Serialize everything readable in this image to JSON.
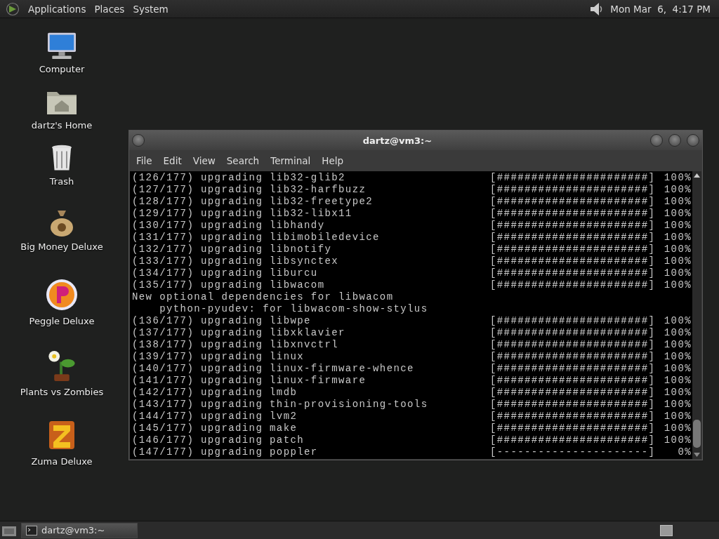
{
  "top_panel": {
    "menus": [
      "Applications",
      "Places",
      "System"
    ],
    "clock": "Mon Mar  6,  4:17 PM"
  },
  "desktop_icons": [
    {
      "label": "Computer",
      "kind": "computer"
    },
    {
      "label": "dartz's Home",
      "kind": "home"
    },
    {
      "label": "Trash",
      "kind": "trash"
    },
    {
      "label": "Big Money Deluxe",
      "kind": "money"
    },
    {
      "label": "Peggle Deluxe",
      "kind": "peggle"
    },
    {
      "label": "Plants vs Zombies",
      "kind": "plants"
    },
    {
      "label": "Zuma Deluxe",
      "kind": "zuma"
    }
  ],
  "terminal": {
    "title": "dartz@vm3:~",
    "menu": [
      "File",
      "Edit",
      "View",
      "Search",
      "Terminal",
      "Help"
    ],
    "lines": [
      {
        "kind": "progress",
        "text": "(126/177) upgrading lib32-glib2",
        "bar": "[######################]",
        "percent": "100%"
      },
      {
        "kind": "progress",
        "text": "(127/177) upgrading lib32-harfbuzz",
        "bar": "[######################]",
        "percent": "100%"
      },
      {
        "kind": "progress",
        "text": "(128/177) upgrading lib32-freetype2",
        "bar": "[######################]",
        "percent": "100%"
      },
      {
        "kind": "progress",
        "text": "(129/177) upgrading lib32-libx11",
        "bar": "[######################]",
        "percent": "100%"
      },
      {
        "kind": "progress",
        "text": "(130/177) upgrading libhandy",
        "bar": "[######################]",
        "percent": "100%"
      },
      {
        "kind": "progress",
        "text": "(131/177) upgrading libimobiledevice",
        "bar": "[######################]",
        "percent": "100%"
      },
      {
        "kind": "progress",
        "text": "(132/177) upgrading libnotify",
        "bar": "[######################]",
        "percent": "100%"
      },
      {
        "kind": "progress",
        "text": "(133/177) upgrading libsynctex",
        "bar": "[######################]",
        "percent": "100%"
      },
      {
        "kind": "progress",
        "text": "(134/177) upgrading liburcu",
        "bar": "[######################]",
        "percent": "100%"
      },
      {
        "kind": "progress",
        "text": "(135/177) upgrading libwacom",
        "bar": "[######################]",
        "percent": "100%"
      },
      {
        "kind": "text",
        "text": "New optional dependencies for libwacom"
      },
      {
        "kind": "text",
        "text": "    python-pyudev: for libwacom-show-stylus"
      },
      {
        "kind": "progress",
        "text": "(136/177) upgrading libwpe",
        "bar": "[######################]",
        "percent": "100%"
      },
      {
        "kind": "progress",
        "text": "(137/177) upgrading libxklavier",
        "bar": "[######################]",
        "percent": "100%"
      },
      {
        "kind": "progress",
        "text": "(138/177) upgrading libxnvctrl",
        "bar": "[######################]",
        "percent": "100%"
      },
      {
        "kind": "progress",
        "text": "(139/177) upgrading linux",
        "bar": "[######################]",
        "percent": "100%"
      },
      {
        "kind": "progress",
        "text": "(140/177) upgrading linux-firmware-whence",
        "bar": "[######################]",
        "percent": "100%"
      },
      {
        "kind": "progress",
        "text": "(141/177) upgrading linux-firmware",
        "bar": "[######################]",
        "percent": "100%"
      },
      {
        "kind": "progress",
        "text": "(142/177) upgrading lmdb",
        "bar": "[######################]",
        "percent": "100%"
      },
      {
        "kind": "progress",
        "text": "(143/177) upgrading thin-provisioning-tools",
        "bar": "[######################]",
        "percent": "100%"
      },
      {
        "kind": "progress",
        "text": "(144/177) upgrading lvm2",
        "bar": "[######################]",
        "percent": "100%"
      },
      {
        "kind": "progress",
        "text": "(145/177) upgrading make",
        "bar": "[######################]",
        "percent": "100%"
      },
      {
        "kind": "progress",
        "text": "(146/177) upgrading patch",
        "bar": "[######################]",
        "percent": "100%"
      },
      {
        "kind": "progress",
        "text": "(147/177) upgrading poppler",
        "bar": "[----------------------]",
        "percent": "0%"
      }
    ]
  },
  "taskbar": {
    "tasks": [
      {
        "label": "dartz@vm3:~",
        "selected": true
      }
    ]
  }
}
